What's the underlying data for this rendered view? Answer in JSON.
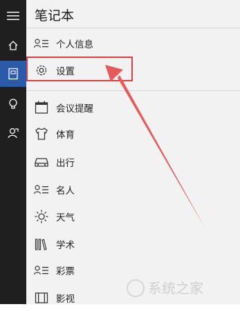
{
  "window": {
    "title": "笔记本"
  },
  "rail": [
    {
      "icon": "hamburger-menu-icon"
    },
    {
      "icon": "home-icon"
    },
    {
      "icon": "notebook-icon",
      "active": true
    },
    {
      "icon": "lightbulb-icon"
    },
    {
      "icon": "feedback-icon"
    }
  ],
  "menu": {
    "personal_info": "个人信息",
    "settings": "设置",
    "meeting_reminder": "会议提醒",
    "sports": "体育",
    "travel": "出行",
    "celebrities": "名人",
    "weather": "天气",
    "academic": "学术",
    "lottery": "彩票",
    "movies": "影视"
  },
  "annotation": {
    "box_color": "#e23b3b",
    "arrow_color": "#e85a5a"
  },
  "watermark": {
    "text": "系统之家"
  },
  "colors": {
    "rail_bg": "#1f1f1f",
    "active_bg": "#2b5aa8",
    "panel_bg": "#f2f2f2"
  }
}
